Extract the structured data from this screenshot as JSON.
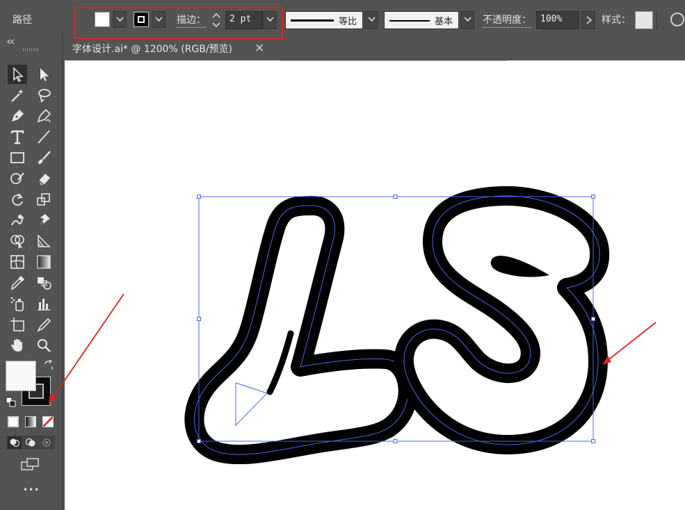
{
  "control_bar": {
    "object_type": "路径",
    "stroke_label": "描边：",
    "stroke_weight": "2 pt",
    "variable_width": "等比",
    "brush_definition": "基本",
    "opacity_label": "不透明度：",
    "opacity_value": "100%",
    "style_label": "样式："
  },
  "document": {
    "tab_title": "字体设计.ai* @ 1200% (RGB/预览)",
    "close_glyph": "×"
  },
  "tools": {
    "more_glyph": "•••"
  },
  "colors": {
    "ui_background": "#535353",
    "annotation_red": "#e02020",
    "selection_blue": "#4a68e0",
    "artwork_stroke": "#000000"
  }
}
